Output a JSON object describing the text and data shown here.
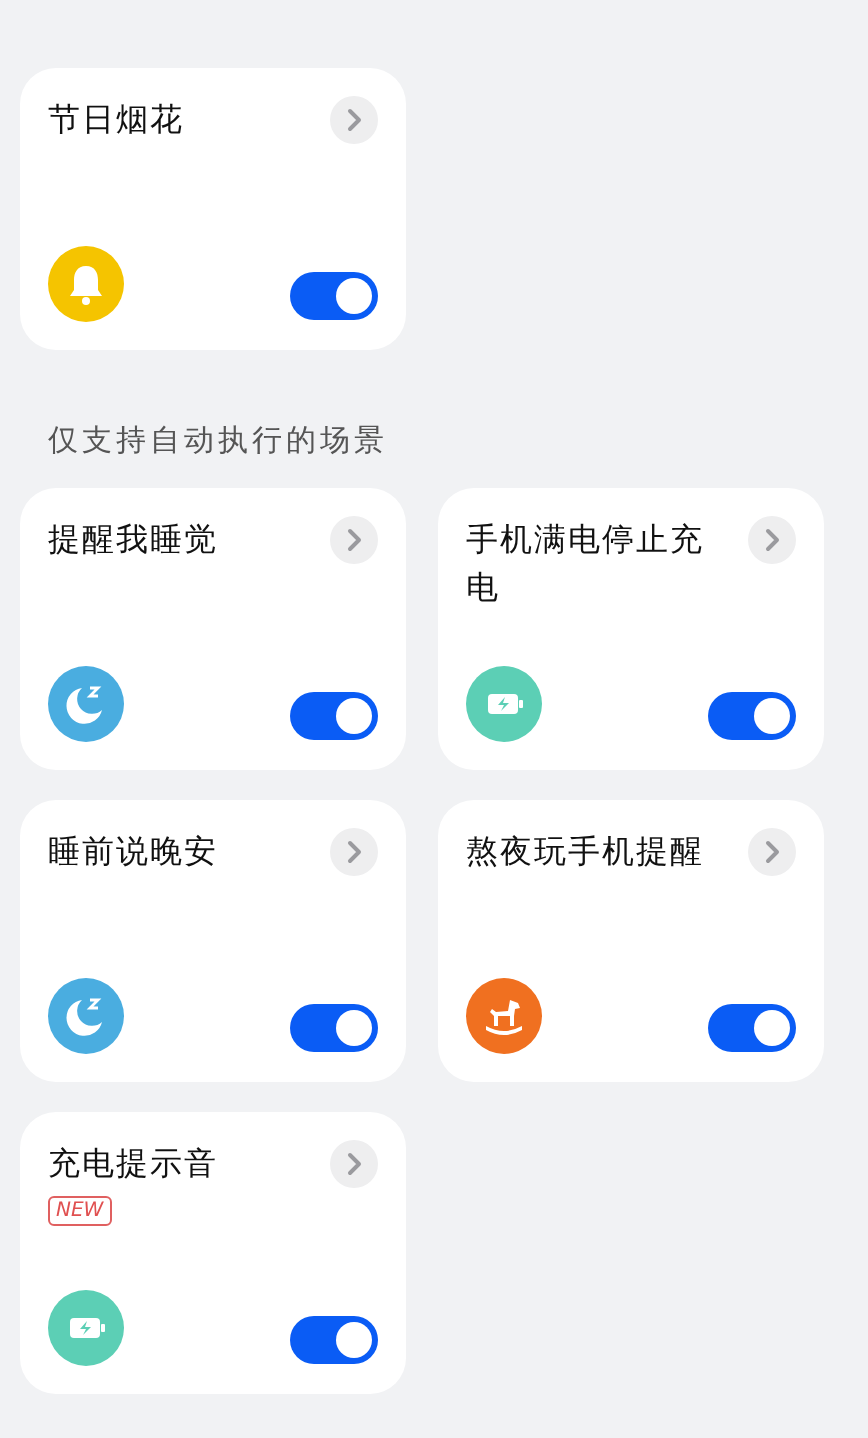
{
  "top_cards": [
    {
      "title": "节日烟花",
      "kind": "bell",
      "color": "#f5c400",
      "on": true
    }
  ],
  "section_label": "仅支持自动执行的场景",
  "cards": [
    {
      "title": "提醒我睡觉",
      "kind": "sleep",
      "color": "#4aade0",
      "on": true
    },
    {
      "title": "手机满电停止充电",
      "kind": "battery",
      "color": "#5ccfb5",
      "on": true
    },
    {
      "title": "睡前说晚安",
      "kind": "sleep",
      "color": "#4aade0",
      "on": true
    },
    {
      "title": "熬夜玩手机提醒",
      "kind": "horse",
      "color": "#f07020",
      "on": true
    },
    {
      "title": "充电提示音",
      "badge": "NEW",
      "kind": "battery",
      "color": "#5ccfb5",
      "on": true
    }
  ]
}
